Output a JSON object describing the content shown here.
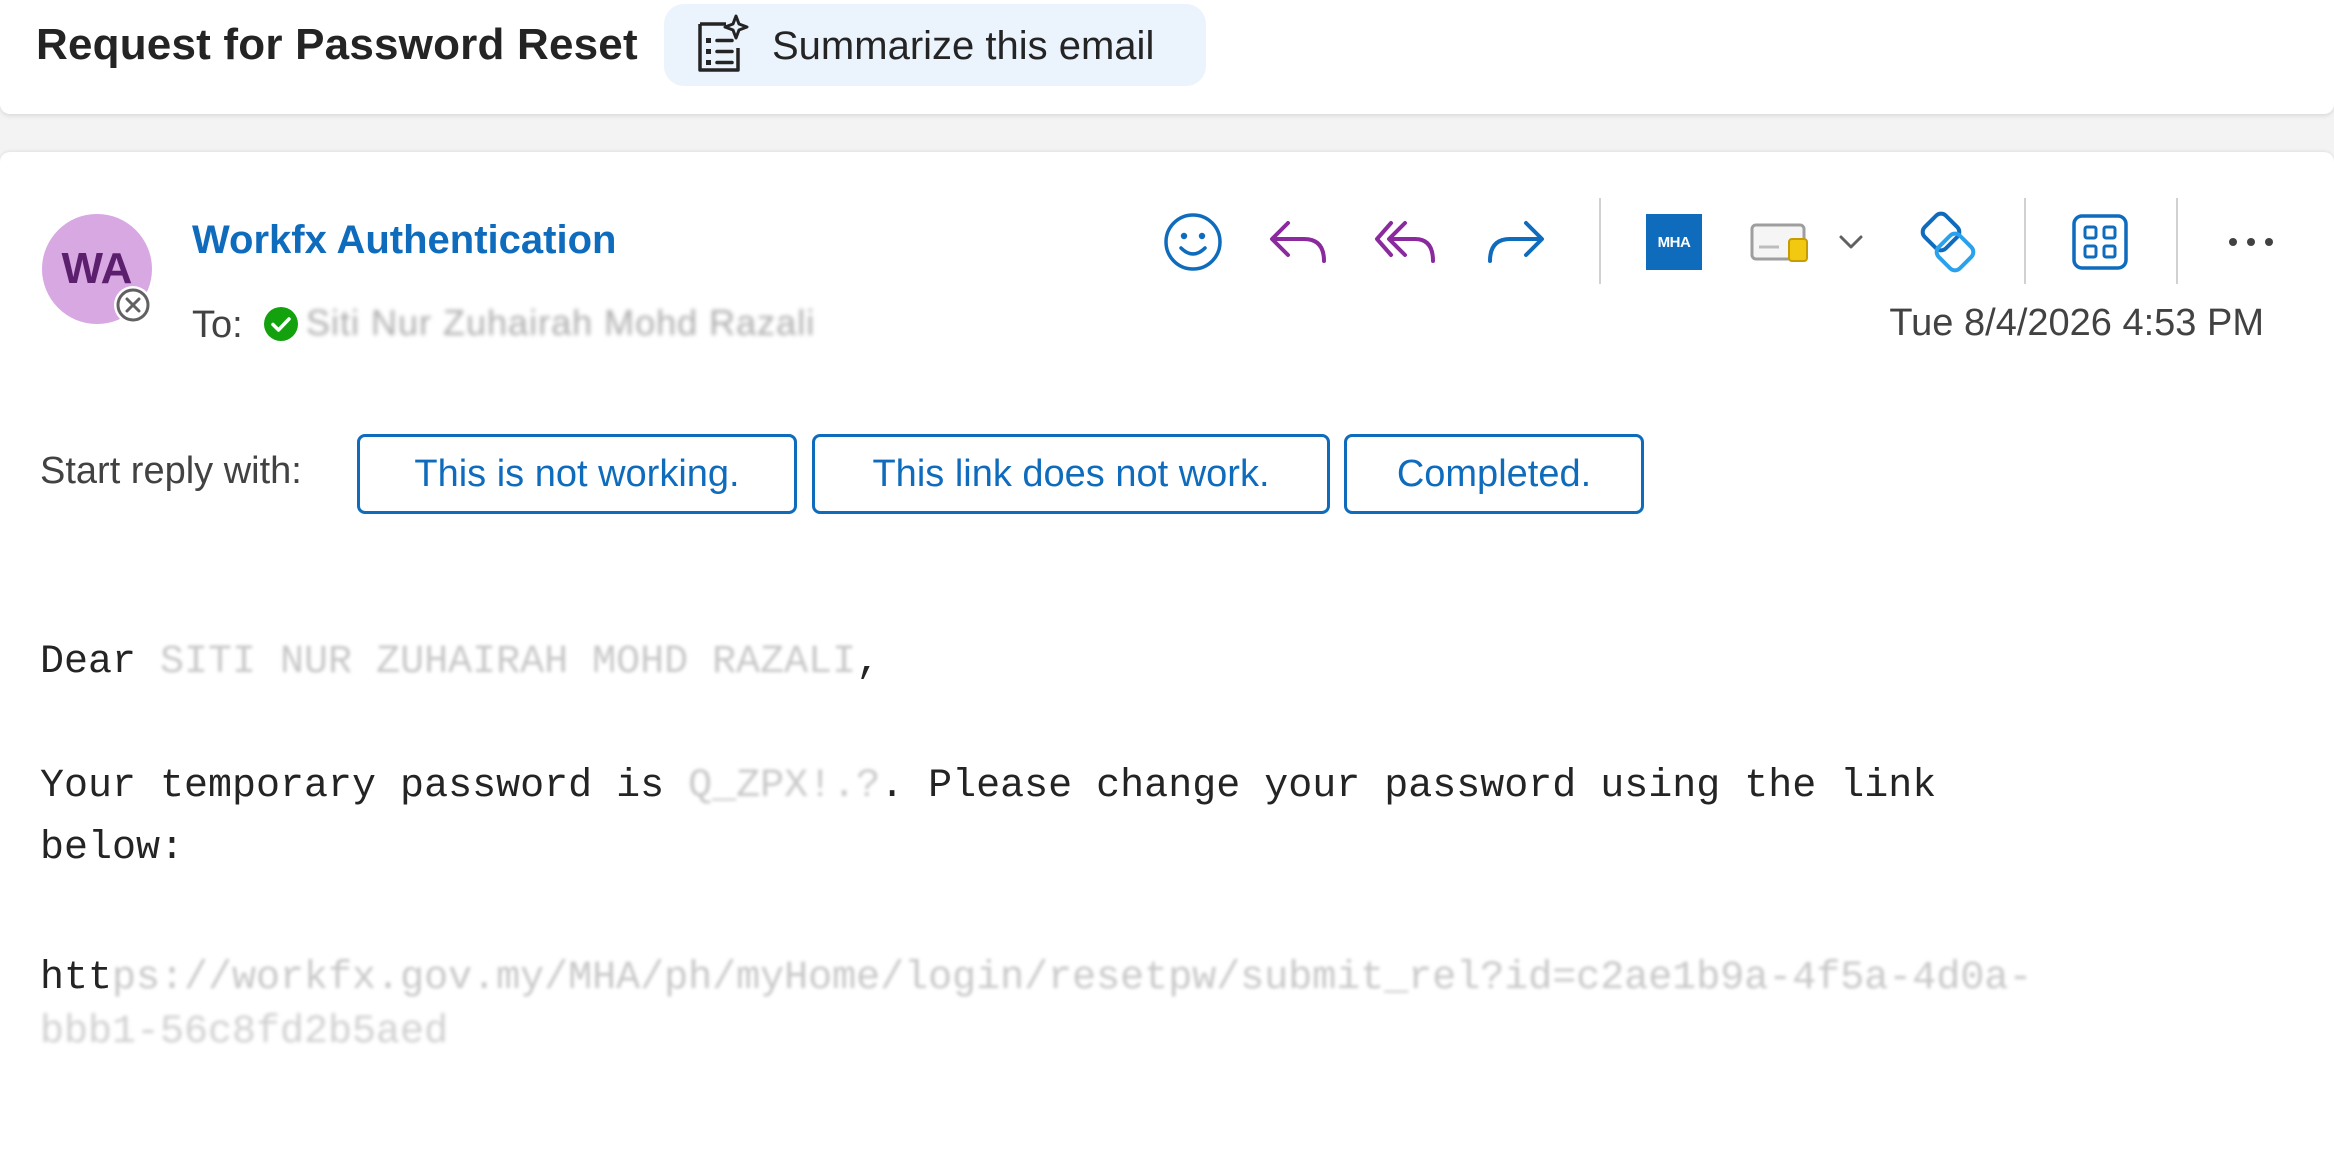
{
  "subject": {
    "title": "Request for Password Reset",
    "summarize_label": "Summarize this email"
  },
  "message": {
    "avatar_initials": "WA",
    "sender_name": "Workfx Authentication",
    "to_label": "To:",
    "recipient_name": "Siti Nur Zuhairah Mohd Razali",
    "datetime": "Tue 8/4/2026 4:53 PM"
  },
  "toolbar": {
    "icons": [
      "emoji-icon",
      "reply-icon",
      "reply-all-icon",
      "forward-icon",
      "mha-app-icon",
      "card-icon",
      "chevron-down-icon",
      "link-icon",
      "apps-icon",
      "more-icon"
    ],
    "mha_label": "MHA",
    "more_label": "···"
  },
  "suggested_replies": {
    "label": "Start reply with:",
    "options": [
      "This is not working.",
      "This link does not work.",
      "Completed."
    ]
  },
  "body": {
    "greeting_prefix": "Dear ",
    "greeting_name": "SITI NUR ZUHAIRAH MOHD RAZALI",
    "greeting_suffix": ",",
    "password_prefix": "Your temporary password is ",
    "password_value": "Q_ZPX!.?",
    "password_suffix": ". Please change your password using the link",
    "password_line2": "below:",
    "link_visible": "htt",
    "link_hidden": "ps://workfx.gov.my/MHA/ph/myHome/login/resetpw/submit_rel?id=c2ae1b9a-4f5a-4d0a-",
    "link_line2": "bbb1-56c8fd2b5aed"
  },
  "colors": {
    "accent": "#0f6cbd",
    "avatar_bg": "#d8a8e2",
    "reply_purple": "#8b2a9e",
    "presence_green": "#13a10e"
  }
}
